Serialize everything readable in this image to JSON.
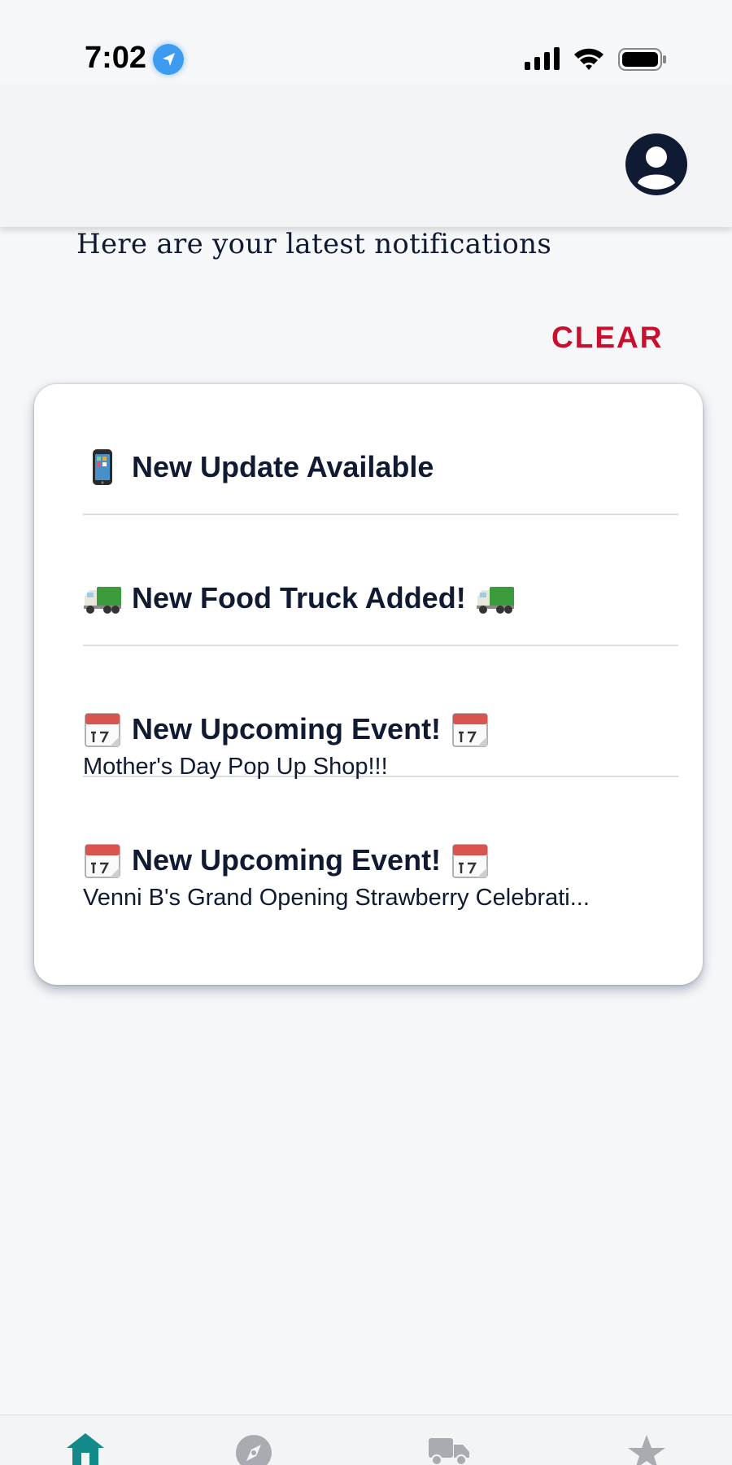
{
  "status_bar": {
    "time": "7:02",
    "icons": [
      "location-icon",
      "signal-icon",
      "wifi-icon",
      "battery-icon"
    ]
  },
  "header": {
    "profile_icon": "user-circle-icon"
  },
  "page": {
    "subtitle": "Here are your latest notifications",
    "clear_label": "CLEAR"
  },
  "notifications": [
    {
      "emoji": "mobile-phone",
      "title": "New Update Available",
      "subtitle": ""
    },
    {
      "emoji": "delivery-truck",
      "title": "New Food Truck Added!",
      "trailing_emoji": "delivery-truck",
      "subtitle": ""
    },
    {
      "emoji": "calendar",
      "title": "New Upcoming Event!",
      "trailing_emoji": "calendar",
      "subtitle": "Mother's Day Pop Up Shop!!!"
    },
    {
      "emoji": "calendar",
      "title": "New Upcoming Event!",
      "trailing_emoji": "calendar",
      "subtitle": "Venni B's Grand Opening Strawberry Celebrati..."
    }
  ],
  "bottom_nav": {
    "items": [
      {
        "icon": "home-icon",
        "active": true
      },
      {
        "icon": "compass-icon",
        "active": false
      },
      {
        "icon": "truck-icon",
        "active": false
      },
      {
        "icon": "star-icon",
        "active": false
      }
    ],
    "active_color": "#128a8a",
    "inactive_color": "#a9abb0"
  },
  "colors": {
    "accent_red": "#c8102e",
    "text_dark": "#111a33",
    "background": "#f6f7f9"
  }
}
